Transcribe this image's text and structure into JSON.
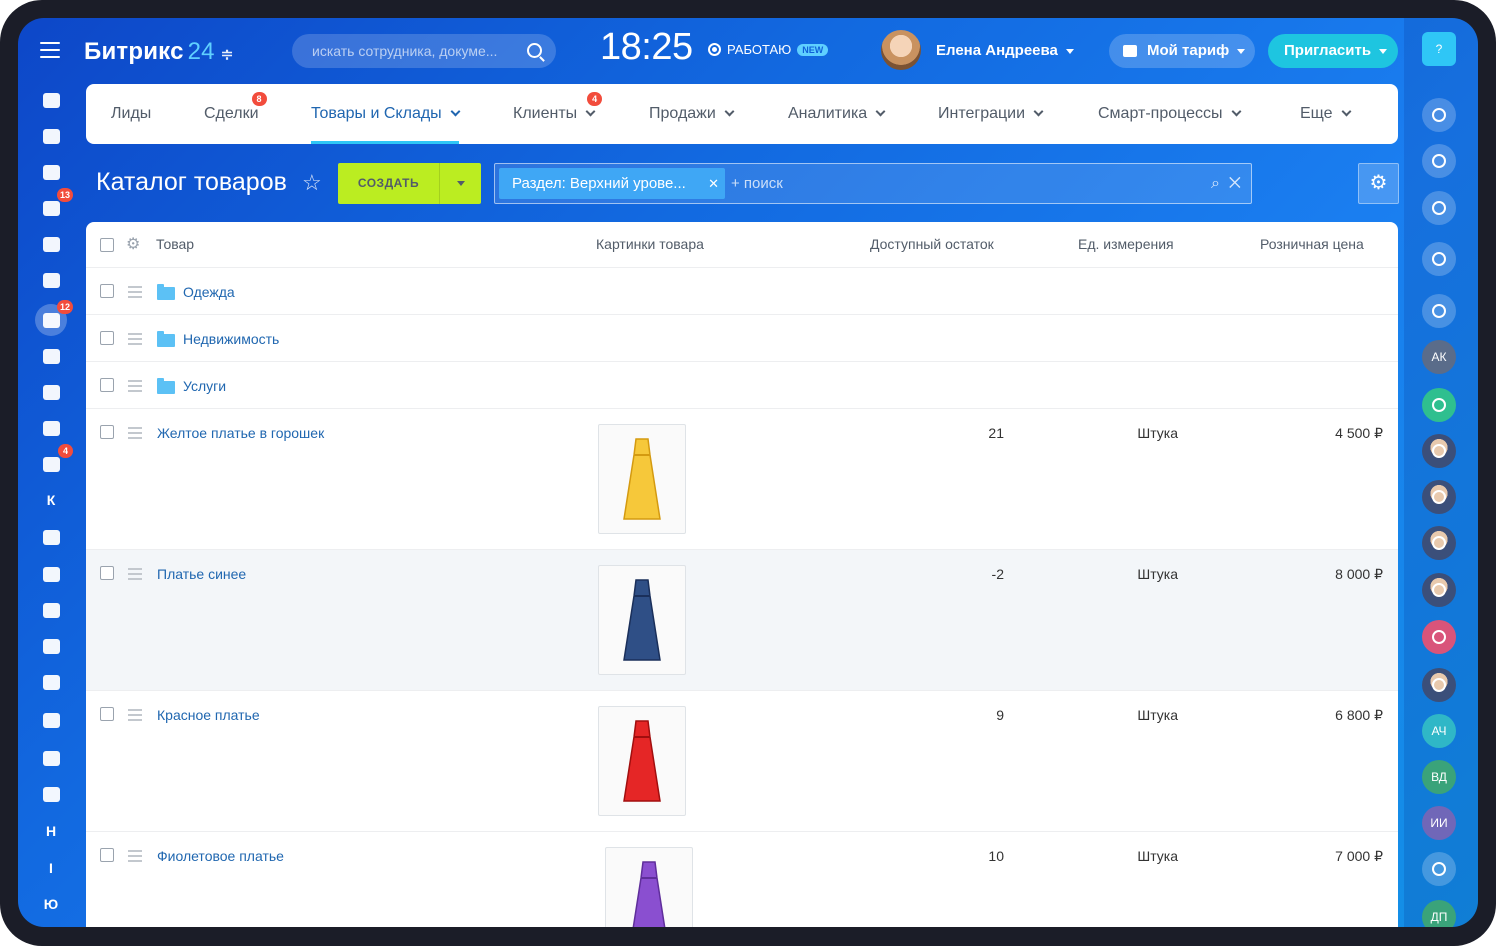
{
  "app": {
    "logo_text": "Битрикс",
    "logo_num": "24",
    "logo_switch": "≑"
  },
  "header": {
    "search_placeholder": "искать сотрудника, докуме...",
    "clock": "18:25",
    "status": "РАБОТАЮ",
    "status_badge": "NEW",
    "user_name": "Елена Андреева",
    "tariff_label": "Мой тариф",
    "invite_label": "Пригласить"
  },
  "left_sidebar": [
    {
      "name": "sidebar-item-feed",
      "icon": "feed-icon",
      "badge": ""
    },
    {
      "name": "sidebar-item-news",
      "icon": "news-icon",
      "badge": ""
    },
    {
      "name": "sidebar-item-chat",
      "icon": "chat-icon",
      "badge": ""
    },
    {
      "name": "sidebar-item-tasks",
      "icon": "tasks-icon",
      "badge": "13"
    },
    {
      "name": "sidebar-item-calendar",
      "icon": "calendar-icon",
      "badge": ""
    },
    {
      "name": "sidebar-item-docs",
      "icon": "document-icon",
      "badge": ""
    },
    {
      "name": "sidebar-item-crm",
      "icon": "crm-funnel-icon",
      "badge": "12"
    },
    {
      "name": "sidebar-item-sign",
      "icon": "signature-icon",
      "badge": ""
    },
    {
      "name": "sidebar-item-drive",
      "icon": "drive-icon",
      "badge": ""
    },
    {
      "name": "sidebar-item-groups",
      "icon": "groups-icon",
      "badge": ""
    },
    {
      "name": "sidebar-item-mail",
      "icon": "mail-icon",
      "badge": "4"
    },
    {
      "name": "sidebar-item-k",
      "letter": "К",
      "badge": ""
    },
    {
      "name": "sidebar-item-company",
      "icon": "building-icon",
      "badge": ""
    },
    {
      "name": "sidebar-item-goals",
      "icon": "target-icon",
      "badge": ""
    },
    {
      "name": "sidebar-item-shop",
      "icon": "cart-icon",
      "badge": ""
    },
    {
      "name": "sidebar-item-contacts",
      "icon": "contact-card-icon",
      "badge": ""
    },
    {
      "name": "sidebar-item-bots",
      "icon": "robot-icon",
      "badge": ""
    },
    {
      "name": "sidebar-item-inventory",
      "icon": "box-icon",
      "badge": ""
    },
    {
      "name": "sidebar-item-forms",
      "icon": "edit-form-icon",
      "badge": ""
    },
    {
      "name": "sidebar-item-analytics",
      "icon": "bar-chart-icon",
      "badge": ""
    },
    {
      "name": "sidebar-item-h",
      "letter": "Н",
      "badge": ""
    },
    {
      "name": "sidebar-item-i",
      "letter": "І",
      "badge": ""
    },
    {
      "name": "sidebar-item-yu",
      "letter": "Ю",
      "badge": ""
    }
  ],
  "nav": {
    "tabs": [
      {
        "label": "Лиды",
        "badge": "",
        "dropdown": false,
        "active": false
      },
      {
        "label": "Сделки",
        "badge": "8",
        "dropdown": false,
        "active": false
      },
      {
        "label": "Товары и Склады",
        "badge": "",
        "dropdown": true,
        "active": true
      },
      {
        "label": "Клиенты",
        "badge": "4",
        "dropdown": true,
        "active": false
      },
      {
        "label": "Продажи",
        "badge": "",
        "dropdown": true,
        "active": false
      },
      {
        "label": "Аналитика",
        "badge": "",
        "dropdown": true,
        "active": false
      },
      {
        "label": "Интеграции",
        "badge": "",
        "dropdown": true,
        "active": false
      },
      {
        "label": "Смарт-процессы",
        "badge": "",
        "dropdown": true,
        "active": false
      },
      {
        "label": "Еще",
        "badge": "",
        "dropdown": true,
        "active": false
      }
    ]
  },
  "toolbar": {
    "page_title": "Каталог товаров",
    "create_label": "СОЗДАТЬ",
    "filter_tag": "Раздел: Верхний урове...",
    "filter_search": "+ поиск"
  },
  "table": {
    "headers": {
      "product": "Товар",
      "images": "Картинки товара",
      "stock": "Доступный остаток",
      "unit": "Ед. измерения",
      "price": "Розничная цена"
    },
    "sections": [
      {
        "label": "Одежда"
      },
      {
        "label": "Недвижимость"
      },
      {
        "label": "Услуги"
      }
    ],
    "products": [
      {
        "name": "Желтое платье в горошек",
        "stock": "21",
        "unit": "Штука",
        "price": "4 500 ₽",
        "color": "#f6c83a",
        "accent": "#d49a10",
        "icon": "yellow-dress-thumbnail"
      },
      {
        "name": "Платье синее",
        "stock": "-2",
        "unit": "Штука",
        "price": "8 000 ₽",
        "color": "#2f4f86",
        "accent": "#1a2f5a",
        "icon": "blue-dress-thumbnail"
      },
      {
        "name": "Красное платье",
        "stock": "9",
        "unit": "Штука",
        "price": "6 800 ₽",
        "color": "#e52626",
        "accent": "#a10e0e",
        "icon": "red-dress-thumbnail"
      },
      {
        "name": "Фиолетовое платье",
        "stock": "10",
        "unit": "Штука",
        "price": "7 000 ₽",
        "color": "#8a4fd0",
        "accent": "#5f2e9b",
        "icon": "purple-dress-thumbnail"
      }
    ]
  },
  "right_sidebar": [
    {
      "name": "help-button",
      "icon": "help-icon",
      "text": "?"
    },
    {
      "name": "openlines-button",
      "icon": "openlines-icon",
      "text": ""
    },
    {
      "name": "notifications-button",
      "icon": "bell-icon",
      "text": ""
    },
    {
      "name": "messages-button",
      "icon": "chat-bubble-icon",
      "text": ""
    },
    {
      "name": "search-button",
      "icon": "search-icon",
      "text": ""
    },
    {
      "name": "general-chat-button",
      "icon": "general-chat-icon",
      "text": ""
    },
    {
      "name": "contact-ak",
      "icon": "",
      "text": "АК"
    },
    {
      "name": "notes-button",
      "icon": "notes-icon",
      "text": ""
    },
    {
      "name": "contact-photo-1",
      "icon": "avatar-photo",
      "text": ""
    },
    {
      "name": "contact-photo-2",
      "icon": "avatar-photo",
      "text": ""
    },
    {
      "name": "contact-photo-3",
      "icon": "avatar-photo",
      "text": ""
    },
    {
      "name": "contact-photo-4",
      "icon": "avatar-photo",
      "text": ""
    },
    {
      "name": "group-chat-button",
      "icon": "group-icon",
      "text": ""
    },
    {
      "name": "contact-photo-5",
      "icon": "avatar-photo",
      "text": ""
    },
    {
      "name": "contact-ach",
      "icon": "",
      "text": "АЧ"
    },
    {
      "name": "contact-vd",
      "icon": "",
      "text": "ВД"
    },
    {
      "name": "contact-ii",
      "icon": "",
      "text": "ИИ"
    },
    {
      "name": "contact-card-button",
      "icon": "contact-card-icon",
      "text": ""
    },
    {
      "name": "contact-dp",
      "icon": "",
      "text": "ДП"
    }
  ]
}
